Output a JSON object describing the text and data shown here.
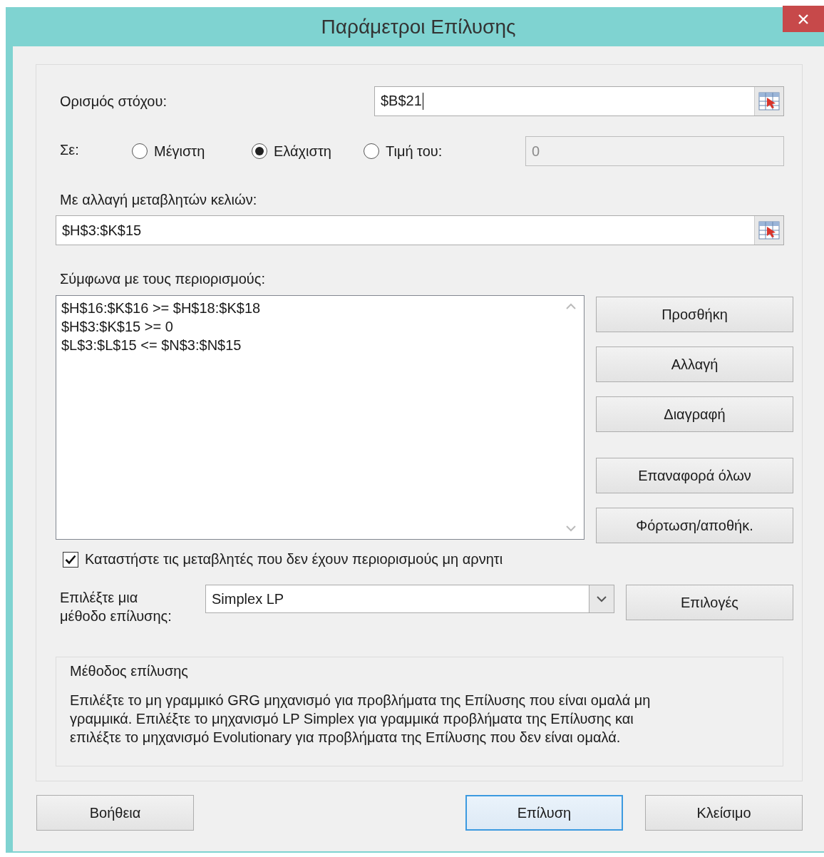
{
  "window": {
    "title": "Παράμετροι Επίλυσης"
  },
  "objective": {
    "label": "Ορισμός στόχου:",
    "value": "$B$21"
  },
  "target": {
    "label": "Σε:",
    "options": [
      {
        "label": "Μέγιστη",
        "selected": false
      },
      {
        "label": "Ελάχιστη",
        "selected": true
      },
      {
        "label": "Τιμή του:",
        "selected": false
      }
    ],
    "value_of": {
      "value": "0",
      "disabled": true
    }
  },
  "changing_cells": {
    "label": "Με αλλαγή μεταβλητών κελιών:",
    "value": "$H$3:$K$15"
  },
  "constraints": {
    "label": "Σύμφωνα με τους περιορισμούς:",
    "items": [
      "$H$16:$K$16 >= $H$18:$K$18",
      "$H$3:$K$15 >= 0",
      "$L$3:$L$15 <= $N$3:$N$15"
    ]
  },
  "constraint_buttons": [
    "Προσθήκη",
    "Αλλαγή",
    "Διαγραφή",
    "Επαναφορά όλων",
    "Φόρτωση/αποθήκ."
  ],
  "nonnegative": {
    "label": "Καταστήστε τις μεταβλητές που δεν έχουν περιορισμούς μη αρνητι",
    "checked": true
  },
  "method": {
    "label_lines": [
      "Επιλέξτε μια",
      "μέθοδο επίλυσης:"
    ],
    "value": "Simplex LP",
    "options_button": "Επιλογές"
  },
  "description": {
    "title": "Μέθοδος επίλυσης",
    "lines": [
      "Επιλέξτε το μη γραμμικό GRG μηχανισμό για προβλήματα της Επίλυσης που είναι ομαλά μη",
      "γραμμικά. Επιλέξτε το μηχανισμό LP Simplex για γραμμικά προβλήματα της Επίλυσης και",
      "επιλέξτε το μηχανισμό Evolutionary για προβλήματα της Επίλυσης που δεν είναι ομαλά."
    ]
  },
  "footer_buttons": [
    {
      "label": "Βοήθεια",
      "focused": false
    },
    {
      "label": "Επίλυση",
      "focused": true
    },
    {
      "label": "Κλείσιμο",
      "focused": false
    }
  ]
}
